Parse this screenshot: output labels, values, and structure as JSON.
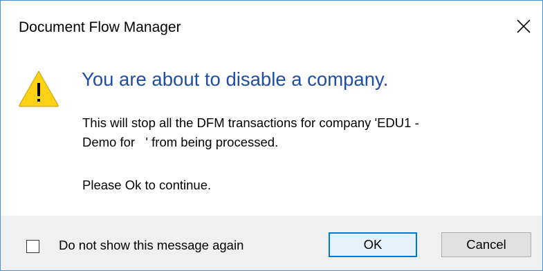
{
  "window": {
    "title": "Document Flow Manager",
    "close_icon": "close-icon"
  },
  "message": {
    "icon": "warning-icon",
    "heading": "You are about to disable a company.",
    "body": "This will stop all the DFM transactions for company 'EDU1 -\nDemo for   ' from being processed.",
    "prompt": "Please Ok to continue."
  },
  "footer": {
    "checkbox_label": "Do not show this message again",
    "checkbox_checked": false,
    "ok_label": "OK",
    "cancel_label": "Cancel"
  },
  "colors": {
    "heading": "#1f4ea3",
    "warning_fill": "#fcd116",
    "footer_bg": "#f0f0f0",
    "default_button_border": "#0078d7"
  }
}
